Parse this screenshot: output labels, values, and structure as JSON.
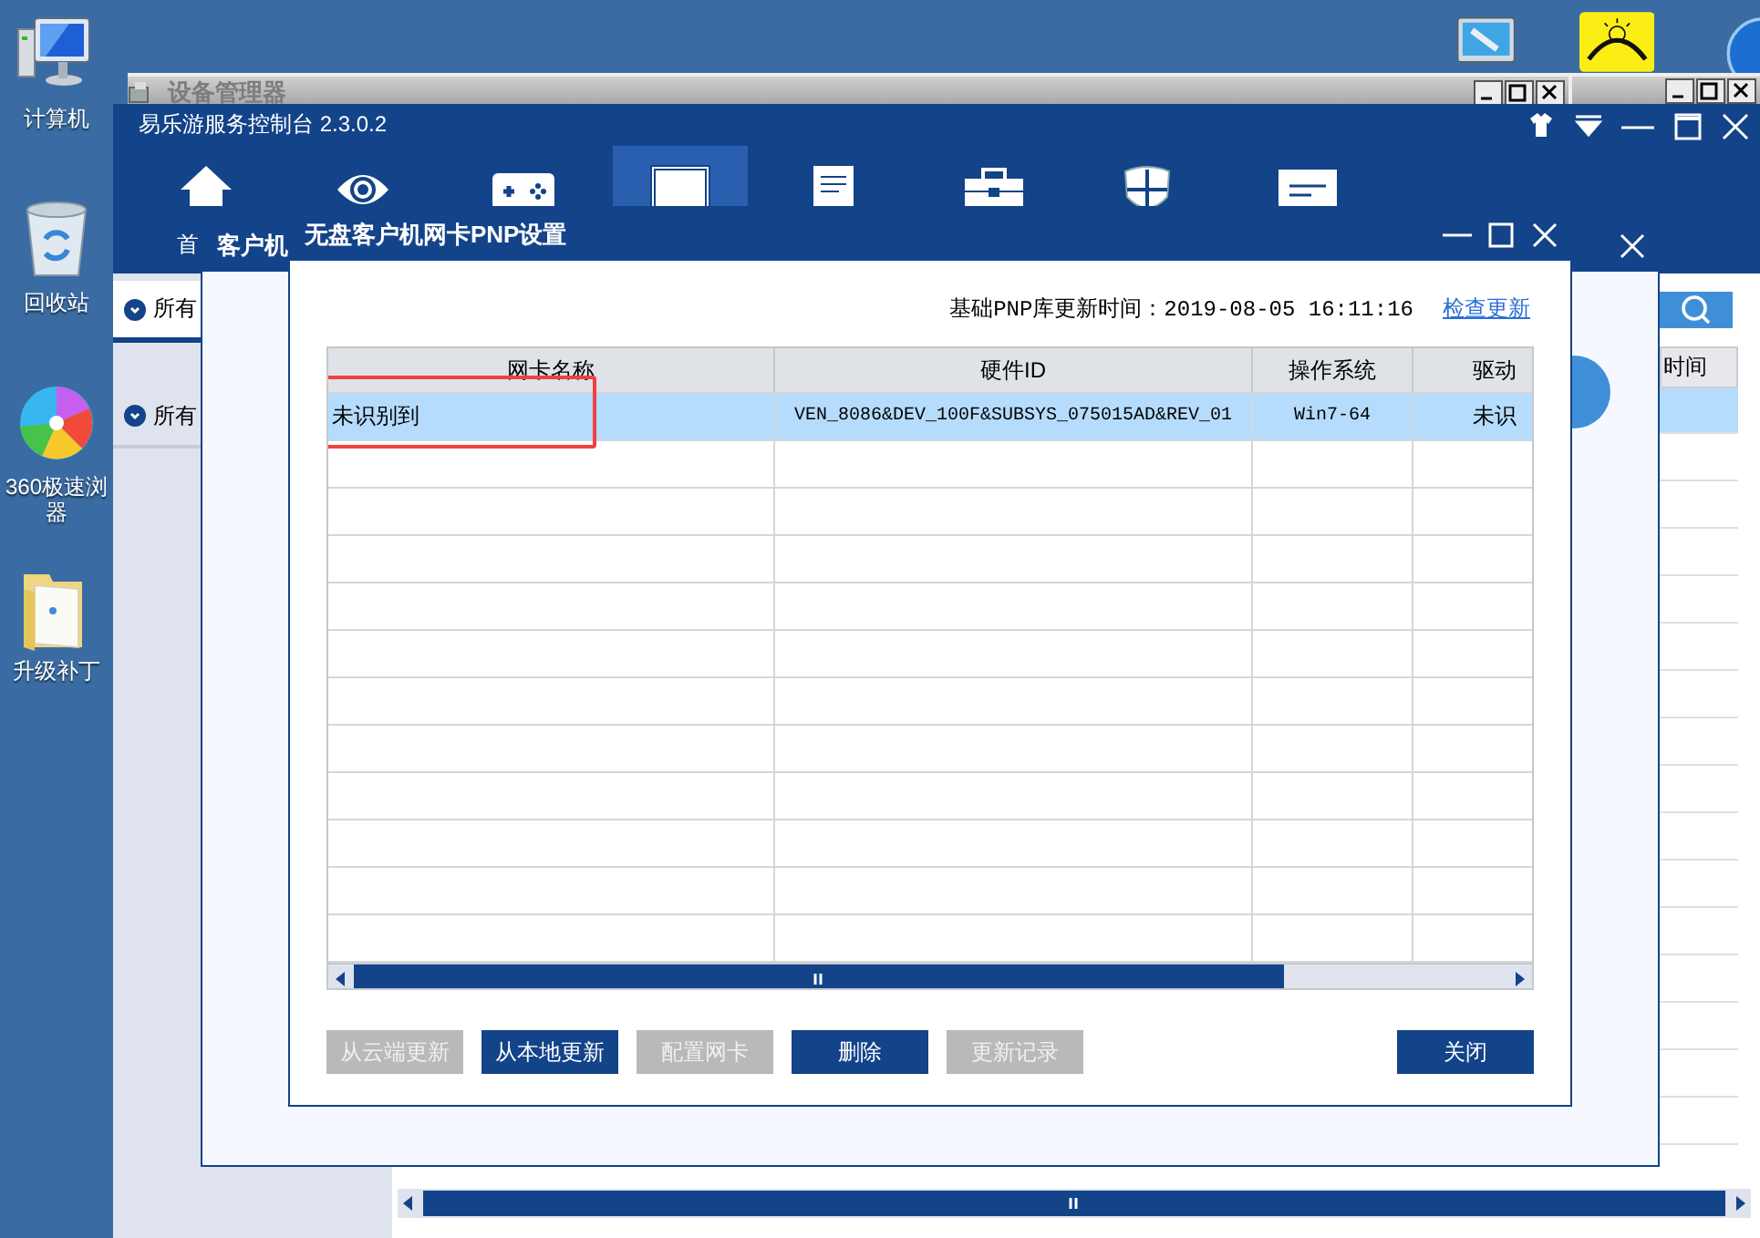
{
  "desktop_icons": [
    {
      "kind": "computer",
      "lines": [
        "计算机"
      ]
    },
    {
      "kind": "recycle",
      "lines": [
        "回收站"
      ]
    },
    {
      "kind": "browser",
      "lines": [
        "360极速浏",
        "器"
      ]
    },
    {
      "kind": "folder",
      "lines": [
        "升级补丁"
      ]
    }
  ],
  "background_window": {
    "title": "设备管理器"
  },
  "main_window": {
    "title": "易乐游服务控制台",
    "version": "2.3.0.2",
    "toolbar": [
      {
        "kind": "home",
        "label": "首",
        "selected": false
      },
      {
        "kind": "eye",
        "selected": false
      },
      {
        "kind": "gamepad",
        "selected": false
      },
      {
        "kind": "window",
        "selected": true
      },
      {
        "kind": "document",
        "selected": false
      },
      {
        "kind": "toolbox",
        "selected": false
      },
      {
        "kind": "shield",
        "selected": false
      },
      {
        "kind": "message",
        "selected": false
      }
    ],
    "sidebar": [
      {
        "label": "所有",
        "selected": true
      },
      {
        "label": "所有",
        "selected": false
      }
    ],
    "table": {
      "columns": [
        "时间"
      ],
      "rows": [
        {
          "selected": true
        }
      ]
    }
  },
  "client_dialog": {
    "title": "客户机"
  },
  "pnp_dialog": {
    "title": "无盘客户机网卡PNP设置",
    "update_info": "基础PNP库更新时间：2019-08-05 16:11:16",
    "check_link": "检查更新",
    "table": {
      "columns": [
        "网卡名称",
        "硬件ID",
        "操作系统",
        "驱动"
      ],
      "rows": [
        {
          "cells": [
            "未识别到",
            "VEN_8086&DEV_100F&SUBSYS_075015AD&REV_01",
            "Win7-64",
            "未识"
          ],
          "selected": true
        }
      ]
    },
    "buttons": [
      {
        "label": "从云端更新",
        "disabled": true,
        "kind": "action"
      },
      {
        "label": "从本地更新",
        "disabled": false,
        "kind": "action"
      },
      {
        "label": "配置网卡",
        "disabled": true,
        "kind": "action"
      },
      {
        "label": "删除",
        "disabled": false,
        "kind": "action"
      },
      {
        "label": "更新记录",
        "disabled": true,
        "kind": "action"
      },
      {
        "label": "关闭",
        "disabled": false,
        "kind": "close"
      }
    ]
  }
}
